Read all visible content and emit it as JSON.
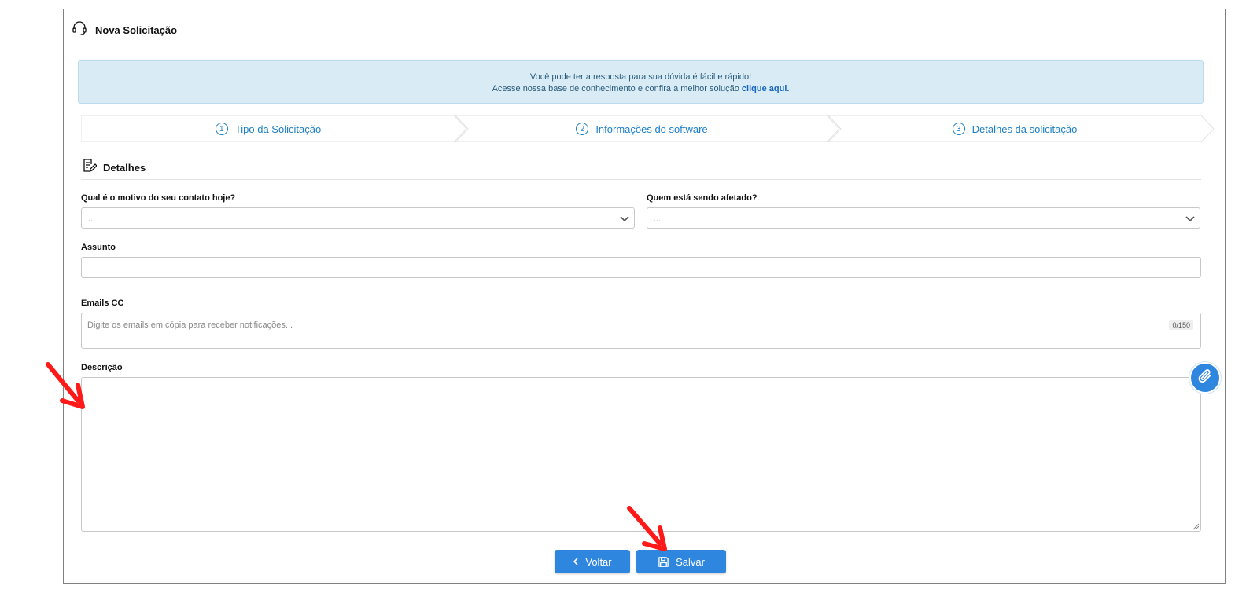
{
  "header": {
    "title": "Nova Solicitação",
    "icon": "headset-icon"
  },
  "banner": {
    "line1": "Você pode ter a resposta para sua dúvida é fácil e rápido!",
    "line2": "Acesse nossa base de conhecimento e confira a melhor solução",
    "link": "clique aqui."
  },
  "steps": [
    {
      "num": "1",
      "label": "Tipo da Solicitação"
    },
    {
      "num": "2",
      "label": "Informações do software"
    },
    {
      "num": "3",
      "label": "Detalhes da solicitação"
    }
  ],
  "section": {
    "title": "Detalhes",
    "icon": "edit-document-icon"
  },
  "form": {
    "motivo": {
      "label": "Qual é o motivo do seu contato hoje?",
      "value": "..."
    },
    "afetado": {
      "label": "Quem está sendo afetado?",
      "value": "..."
    },
    "assunto": {
      "label": "Assunto",
      "value": ""
    },
    "emails": {
      "label": "Emails CC",
      "placeholder": "Digite os emails em cópia para receber notificações...",
      "counter": "0/150"
    },
    "descricao": {
      "label": "Descrição",
      "value": ""
    }
  },
  "buttons": {
    "back": "Voltar",
    "save": "Salvar"
  },
  "colors": {
    "accent": "#2f86de",
    "step_text": "#1b7fc7",
    "banner_bg": "#d9ecf6",
    "annotation": "#ff0000"
  }
}
